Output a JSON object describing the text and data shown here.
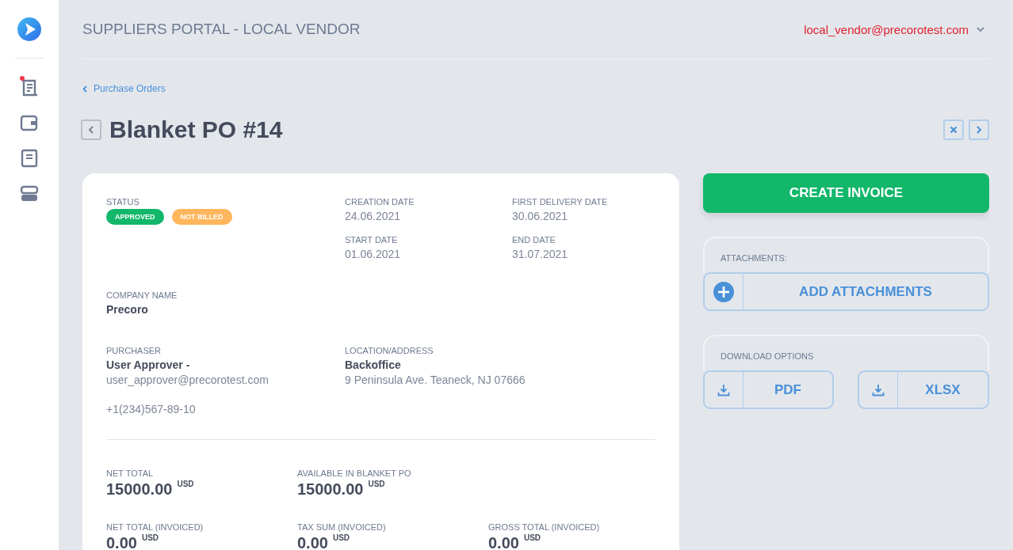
{
  "sidebar": {
    "items": [
      {
        "kind": "orders",
        "notification": true
      },
      {
        "kind": "wallet",
        "notification": false
      },
      {
        "kind": "document",
        "notification": false
      },
      {
        "kind": "server",
        "notification": false
      }
    ]
  },
  "header": {
    "title": "SUPPLIERS PORTAL - LOCAL VENDOR",
    "user": "local_vendor@precorotest.com"
  },
  "breadcrumb": "Purchase Orders",
  "page_title": "Blanket PO #14",
  "details": {
    "status_label": "STATUS",
    "statuses": [
      {
        "label": "APPROVED",
        "color": "#12b76a"
      },
      {
        "label": "NOT BILLED",
        "color": "#ffb65c"
      }
    ],
    "dates": [
      {
        "label": "CREATION DATE",
        "value": "24.06.2021"
      },
      {
        "label": "FIRST DELIVERY DATE",
        "value": "30.06.2021"
      },
      {
        "label": "START DATE",
        "value": "01.06.2021"
      },
      {
        "label": "END DATE",
        "value": "31.07.2021"
      }
    ],
    "company": {
      "label": "COMPANY NAME",
      "value": "Precoro"
    },
    "purchaser": {
      "label": "PURCHASER",
      "name": "User Approver -",
      "email": "user_approver@precorotest.com",
      "phone": "+1(234)567-89-10"
    },
    "location": {
      "label": "LOCATION/ADDRESS",
      "name": "Backoffice",
      "address": "9 Peninsula Ave. Teaneck, NJ 07666"
    },
    "totals": [
      {
        "label": "NET TOTAL",
        "value": "15000.00",
        "currency": "USD"
      },
      {
        "label": "AVAILABLE IN BLANKET PO",
        "value": "15000.00",
        "currency": "USD"
      }
    ],
    "invoiced": [
      {
        "label": "NET TOTAL (INVOICED)",
        "value": "0.00",
        "currency": "USD"
      },
      {
        "label": "TAX SUM (INVOICED)",
        "value": "0.00",
        "currency": "USD"
      },
      {
        "label": "GROSS TOTAL (INVOICED)",
        "value": "0.00",
        "currency": "USD"
      }
    ]
  },
  "actions": {
    "create": "CREATE INVOICE",
    "attachments_label": "ATTACHMENTS:",
    "add_attachments": "ADD ATTACHMENTS",
    "download_label": "DOWNLOAD OPTIONS",
    "downloads": [
      "PDF",
      "XLSX"
    ]
  }
}
